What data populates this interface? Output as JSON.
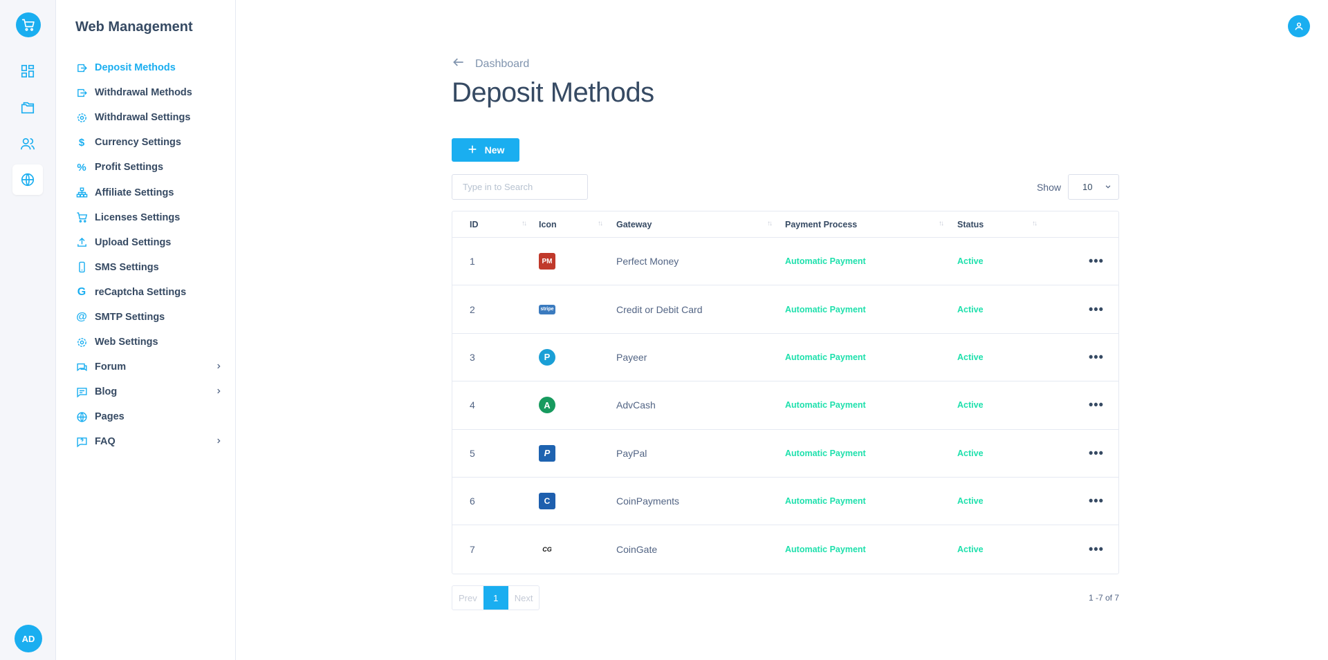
{
  "sidebar": {
    "title": "Web Management",
    "items": [
      {
        "label": "Deposit Methods",
        "icon": "deposit-icon",
        "active": true
      },
      {
        "label": "Withdrawal Methods",
        "icon": "withdrawal-icon"
      },
      {
        "label": "Withdrawal Settings",
        "icon": "gear-icon"
      },
      {
        "label": "Currency Settings",
        "icon": "dollar-icon"
      },
      {
        "label": "Profit Settings",
        "icon": "percent-icon"
      },
      {
        "label": "Affiliate Settings",
        "icon": "hierarchy-icon"
      },
      {
        "label": "Licenses Settings",
        "icon": "cart-icon"
      },
      {
        "label": "Upload Settings",
        "icon": "upload-icon"
      },
      {
        "label": "SMS Settings",
        "icon": "mobile-icon"
      },
      {
        "label": "reCaptcha Settings",
        "icon": "google-icon"
      },
      {
        "label": "SMTP Settings",
        "icon": "at-icon"
      },
      {
        "label": "Web Settings",
        "icon": "gear-icon"
      },
      {
        "label": "Forum",
        "icon": "chat-icon",
        "has_children": true
      },
      {
        "label": "Blog",
        "icon": "message-icon",
        "has_children": true
      },
      {
        "label": "Pages",
        "icon": "globe-icon"
      },
      {
        "label": "FAQ",
        "icon": "help-icon",
        "has_children": true
      }
    ]
  },
  "rail": {
    "avatar_initials": "AD"
  },
  "header": {
    "back_label": "Dashboard",
    "title": "Deposit Methods"
  },
  "toolbar": {
    "new_label": "New",
    "search_placeholder": "Type in to Search",
    "show_label": "Show",
    "show_value": "10"
  },
  "table": {
    "columns": [
      "ID",
      "Icon",
      "Gateway",
      "Payment Process",
      "Status"
    ],
    "rows": [
      {
        "id": "1",
        "gateway": "Perfect Money",
        "process": "Automatic Payment",
        "status": "Active",
        "icon": "perfect-money-icon",
        "icon_text": "PM",
        "icon_color": "#c0392b"
      },
      {
        "id": "2",
        "gateway": "Credit or Debit Card",
        "process": "Automatic Payment",
        "status": "Active",
        "icon": "stripe-icon",
        "icon_text": "stripe",
        "icon_color": "#3b7bbf"
      },
      {
        "id": "3",
        "gateway": "Payeer",
        "process": "Automatic Payment",
        "status": "Active",
        "icon": "payeer-icon",
        "icon_text": "P",
        "icon_color": "#1a9fd6"
      },
      {
        "id": "4",
        "gateway": "AdvCash",
        "process": "Automatic Payment",
        "status": "Active",
        "icon": "advcash-icon",
        "icon_text": "A",
        "icon_color": "#179a5e"
      },
      {
        "id": "5",
        "gateway": "PayPal",
        "process": "Automatic Payment",
        "status": "Active",
        "icon": "paypal-icon",
        "icon_text": "P",
        "icon_color": "#1e63b0"
      },
      {
        "id": "6",
        "gateway": "CoinPayments",
        "process": "Automatic Payment",
        "status": "Active",
        "icon": "coinpayments-icon",
        "icon_text": "C",
        "icon_color": "#1e5fae"
      },
      {
        "id": "7",
        "gateway": "CoinGate",
        "process": "Automatic Payment",
        "status": "Active",
        "icon": "coingate-icon",
        "icon_text": "CG",
        "icon_color": "#ffffff"
      }
    ]
  },
  "pagination": {
    "prev": "Prev",
    "current": "1",
    "next": "Next",
    "range": "1 -7 of 7"
  },
  "colors": {
    "accent": "#1aaef0",
    "success": "#1ee0ac",
    "text": "#364a63"
  }
}
